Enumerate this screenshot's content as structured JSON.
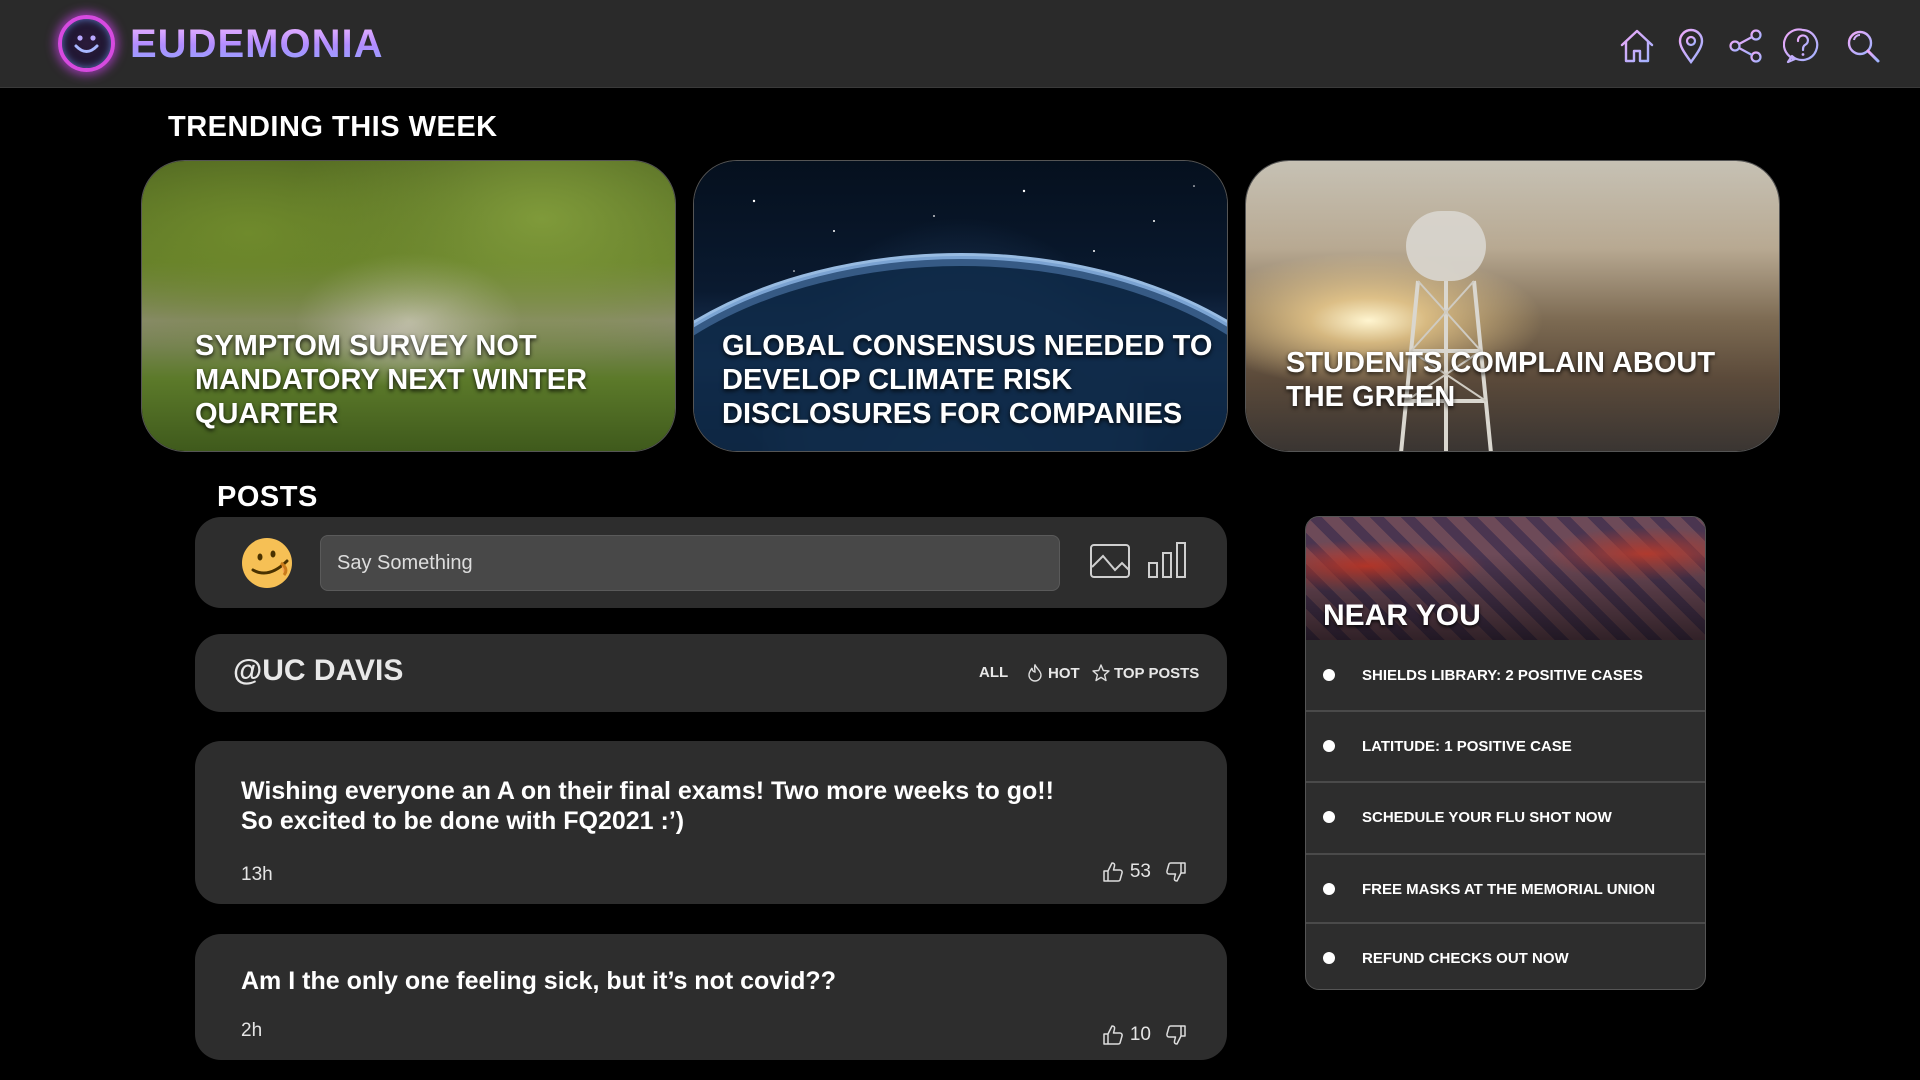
{
  "app": {
    "brand": "EUDEMONIA"
  },
  "nav": {
    "items": [
      {
        "icon": "home-icon"
      },
      {
        "icon": "location-pin-icon"
      },
      {
        "icon": "share-icon"
      },
      {
        "icon": "help-icon"
      },
      {
        "icon": "search-icon"
      }
    ]
  },
  "trending": {
    "title": "TRENDING THIS WEEK",
    "cards": [
      {
        "headline": "SYMPTOM SURVEY NOT MANDATORY NEXT WINTER QUARTER"
      },
      {
        "headline": "GLOBAL CONSENSUS NEEDED TO DEVELOP CLIMATE RISK DISCLOSURES FOR COMPANIES"
      },
      {
        "headline": "STUDENTS COMPLAIN ABOUT THE GREEN"
      }
    ]
  },
  "posts": {
    "title": "POSTS",
    "composer": {
      "placeholder": "Say Something"
    },
    "feed": {
      "title": "@UC DAVIS",
      "filters": [
        "ALL",
        "HOT",
        "TOP POSTS"
      ]
    },
    "items": [
      {
        "text": "Wishing everyone an A on their final exams! Two more weeks to go!!\nSo excited to be done with FQ2021 :’)",
        "time": "13h",
        "likes": "53"
      },
      {
        "text": "Am I the only one feeling sick, but it’s not covid??",
        "time": "2h",
        "likes": "10"
      }
    ]
  },
  "near_you": {
    "title": "NEAR YOU",
    "items": [
      "SHIELDS LIBRARY: 2 POSITIVE CASES",
      "LATITUDE:  1 POSITIVE CASE",
      "SCHEDULE YOUR FLU SHOT NOW",
      "FREE MASKS AT THE MEMORIAL UNION",
      "REFUND CHECKS OUT NOW"
    ]
  },
  "colors": {
    "background": "#000000",
    "topbar": "#2a2a2a",
    "panel": "#2d2d2d",
    "input": "#484848",
    "brand_accent": "#c8a0ff",
    "nav_icon_stroke": "#e9a6f5"
  }
}
